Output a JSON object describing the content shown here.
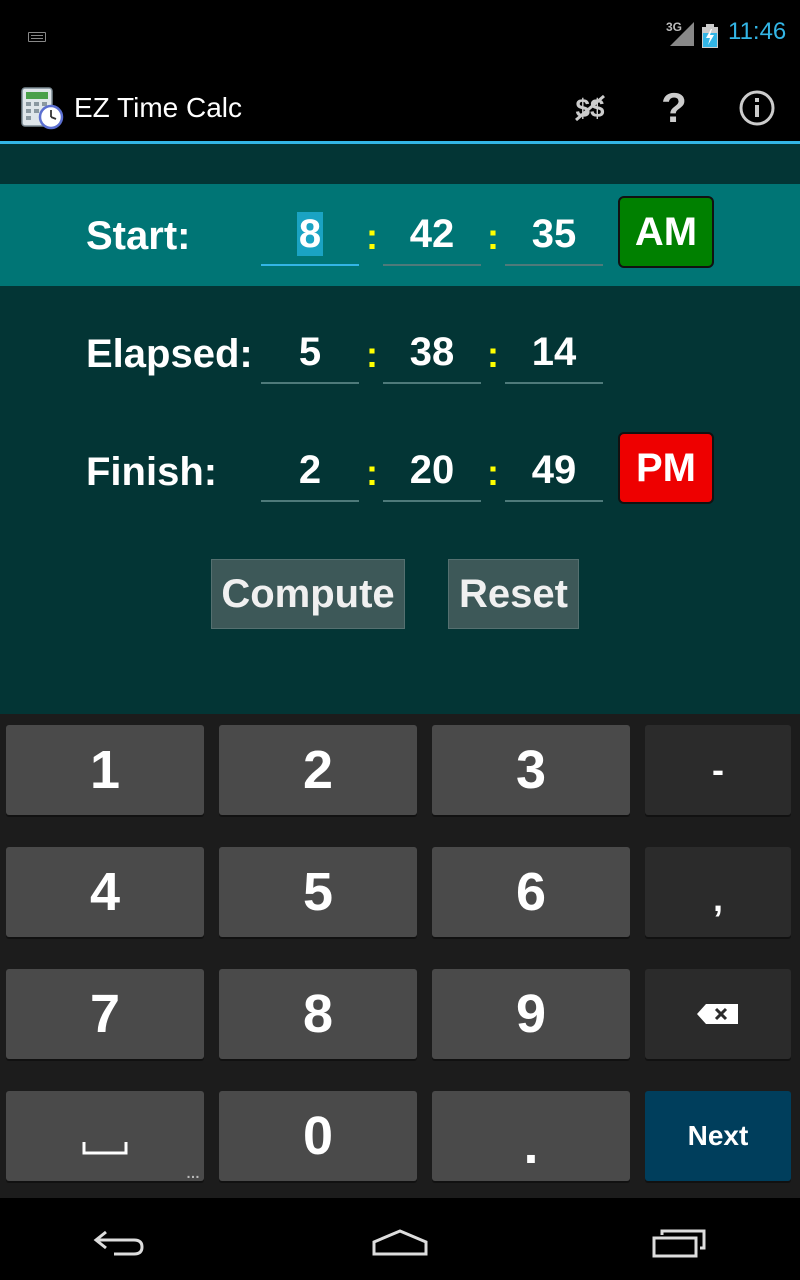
{
  "status_bar": {
    "network": "3G",
    "time": "11:46"
  },
  "action_bar": {
    "title": "EZ Time Calc",
    "help_label": "?"
  },
  "rows": {
    "start": {
      "label": "Start:",
      "hours": "8",
      "minutes": "42",
      "seconds": "35",
      "ampm": "AM"
    },
    "elapsed": {
      "label": "Elapsed:",
      "hours": "5",
      "minutes": "38",
      "seconds": "14"
    },
    "finish": {
      "label": "Finish:",
      "hours": "2",
      "minutes": "20",
      "seconds": "49",
      "ampm": "PM"
    }
  },
  "separator": ":",
  "buttons": {
    "compute": "Compute",
    "reset": "Reset"
  },
  "keyboard": {
    "keys": [
      "1",
      "2",
      "3",
      "-",
      "4",
      "5",
      "6",
      ",",
      "7",
      "8",
      "9",
      "⌫",
      "␣",
      "0",
      ".",
      "Next"
    ],
    "space_glyph": "⎵",
    "next_label": "Next"
  },
  "colors": {
    "accent": "#33b5e5",
    "am_bg": "#008000",
    "pm_bg": "#ee0000",
    "colon": "#ffff00",
    "active_row": "#007575",
    "content_bg": "#033535"
  }
}
